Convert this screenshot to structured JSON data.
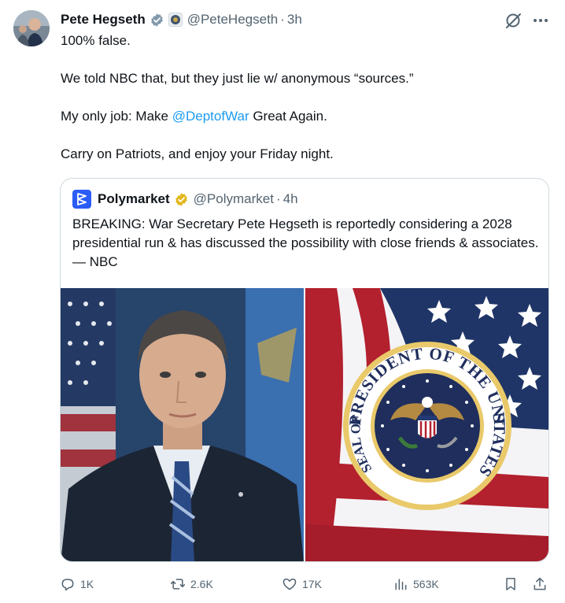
{
  "tweet": {
    "author_name": "Pete Hegseth",
    "handle": "@PeteHegseth",
    "separator": "·",
    "time": "3h",
    "lines": [
      "100% false.",
      "We told NBC that, but they just lie w/ anonymous “sources.”",
      "My only job: Make ",
      "Carry on Patriots, and enjoy your Friday night."
    ],
    "mention": "@DeptofWar",
    "line3_tail": " Great Again."
  },
  "quote": {
    "author_name": "Polymarket",
    "handle": "@Polymarket",
    "separator": "·",
    "time": "4h",
    "text": "BREAKING: War Secretary Pete Hegseth is reportedly considering a 2028 presidential run & has discussed the possibility with close friends & associates. — NBC",
    "seal_text_top": "PRESIDENT OF THE UNITED",
    "seal_text_bottom": "SEAL OF THE",
    "seal_text_right": "STATES"
  },
  "actions": {
    "replies": "1K",
    "reposts": "2.6K",
    "likes": "17K",
    "views": "563K"
  },
  "colors": {
    "text": "#0f1419",
    "secondary": "#536471",
    "link": "#1d9bf0",
    "verified_gray": "#829aab",
    "verified_gold": "#e2b719",
    "polymarket_blue": "#2c5cf6"
  },
  "icons": [
    "verified-gray-icon",
    "affiliate-badge-icon",
    "grok-icon",
    "more-icon",
    "verified-gold-icon",
    "polymarket-logo",
    "reply-icon",
    "repost-icon",
    "like-icon",
    "views-icon",
    "bookmark-icon",
    "share-icon"
  ]
}
